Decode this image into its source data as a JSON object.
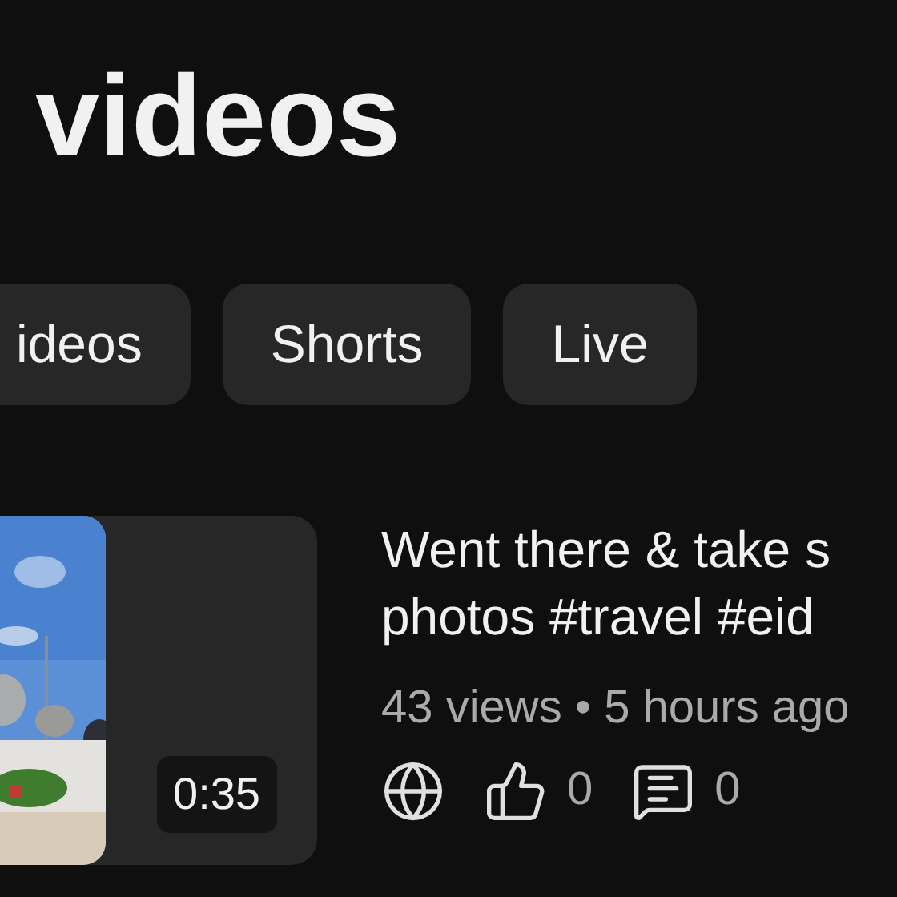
{
  "heading": "videos",
  "chips": [
    {
      "label": "ideos",
      "selected": false
    },
    {
      "label": "Shorts",
      "selected": false
    },
    {
      "label": "Live",
      "selected": false
    }
  ],
  "video": {
    "thumbnail": {
      "kind": "picture"
    },
    "duration": "0:35",
    "title_lines": [
      "Went there & take s",
      "photos #travel #eid"
    ],
    "meta": "43 views • 5 hours ago",
    "likes": "0",
    "comments": "0"
  }
}
